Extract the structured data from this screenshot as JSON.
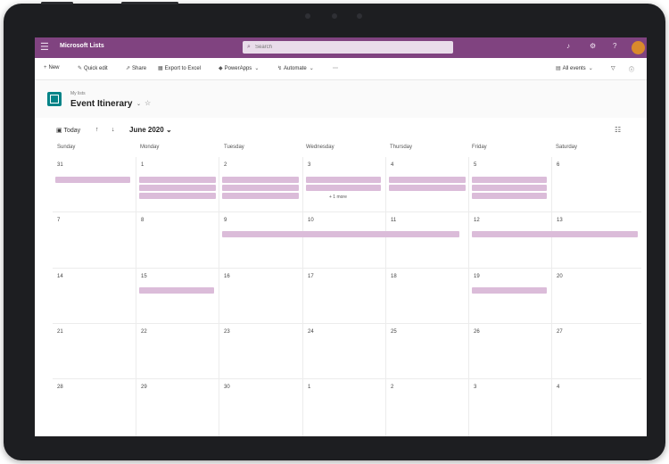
{
  "app": {
    "name": "Microsoft Lists",
    "search_placeholder": "Search"
  },
  "suitebar_icons": [
    "bell-icon",
    "gear-icon",
    "help-icon"
  ],
  "commands": {
    "new": "New",
    "quick_edit": "Quick edit",
    "share": "Share",
    "export": "Export to Excel",
    "power_apps": "PowerApps",
    "automate": "Automate",
    "more": "⋯",
    "view": "All events"
  },
  "list": {
    "breadcrumb": "My lists",
    "title": "Event Itinerary"
  },
  "calendar": {
    "today": "Today",
    "month": "June 2020",
    "days": [
      "Sunday",
      "Monday",
      "Tuesday",
      "Wednesday",
      "Thursday",
      "Friday",
      "Saturday"
    ],
    "weeks": [
      [
        "31",
        "1",
        "2",
        "3",
        "4",
        "5",
        "6"
      ],
      [
        "7",
        "8",
        "9",
        "10",
        "11",
        "12",
        "13"
      ],
      [
        "14",
        "15",
        "16",
        "17",
        "18",
        "19",
        "20"
      ],
      [
        "21",
        "22",
        "23",
        "24",
        "25",
        "26",
        "27"
      ],
      [
        "28",
        "29",
        "30",
        "1",
        "2",
        "3",
        "4"
      ]
    ],
    "more_link": "+ 1 more"
  },
  "colors": {
    "suitebar": "#804380",
    "event_fill": "#dbbcd9",
    "list_icon": "#038387"
  }
}
